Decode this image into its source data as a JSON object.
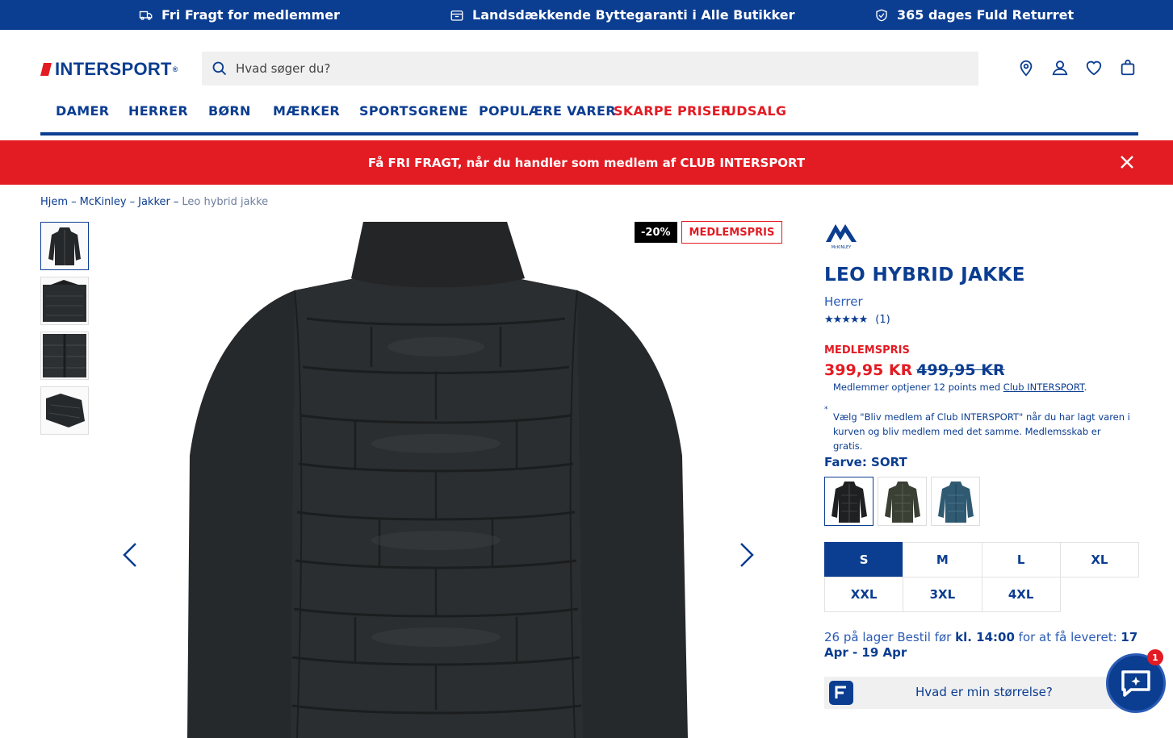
{
  "topbar": {
    "items": [
      {
        "icon": "truck-icon",
        "text": "Fri Fragt for medlemmer"
      },
      {
        "icon": "store-icon",
        "text": "Landsdækkende Byttegaranti i Alle Butikker"
      },
      {
        "icon": "shield-check-icon",
        "text": "365 dages Fuld Returret"
      }
    ]
  },
  "header": {
    "logo_text": "INTERSPORT",
    "search_placeholder": "Hvad søger du?",
    "icons": [
      "location-icon",
      "account-icon",
      "wishlist-icon",
      "basket-icon"
    ]
  },
  "nav": {
    "items": [
      {
        "label": "DAMER"
      },
      {
        "label": "HERRER"
      },
      {
        "label": "BØRN"
      },
      {
        "label": "MÆRKER"
      },
      {
        "label": "SPORTSGRENE"
      },
      {
        "label": "POPULÆRE VARER"
      },
      {
        "label": "SKARPE PRISER"
      },
      {
        "label": "UDSALG"
      }
    ]
  },
  "promo": {
    "text": "Få FRI FRAGT, når du handler som medlem af CLUB INTERSPORT"
  },
  "breadcrumb": {
    "items": [
      "Hjem",
      "McKinley",
      "Jakker"
    ],
    "separator": "–",
    "current": "Leo hybrid jakke"
  },
  "product": {
    "brand_label": "McKINLEY",
    "badge_discount": "-20%",
    "badge_member": "MEDLEMSPRIS",
    "title": "LEO HYBRID JAKKE",
    "gender": "Herrer",
    "rating_stars": "★★★★★",
    "rating_count": "(1)",
    "member_label": "MEDLEMSPRIS",
    "price_now": "399,95 KR",
    "price_old": "499,95 KR",
    "points_text": "Medlemmer optjener 12 points med ",
    "points_link": "Club INTERSPORT",
    "points_end": ".",
    "note_mark": "*",
    "note": "Vælg \"Bliv medlem af Club INTERSPORT\" når du har lagt varen i kurven og bliv medlem med det samme. Medlemsskab er gratis.",
    "color_label": "Farve: SORT",
    "colors": [
      "#1e2022",
      "#3a4034",
      "#2f5a72"
    ],
    "sizes": [
      "S",
      "M",
      "L",
      "XL",
      "XXL",
      "3XL",
      "4XL"
    ],
    "selected_size": "S",
    "stock_prefix": "26 på lager Bestil før ",
    "stock_time": "kl. 14:00",
    "stock_mid": " for at få leveret: ",
    "stock_dates": "17 Apr - 19 Apr",
    "size_help": "Hvad er min størrelse?"
  },
  "chat": {
    "badge": "1"
  },
  "colors": {
    "brand_blue": "#0b3d91",
    "brand_red": "#e31b23"
  }
}
